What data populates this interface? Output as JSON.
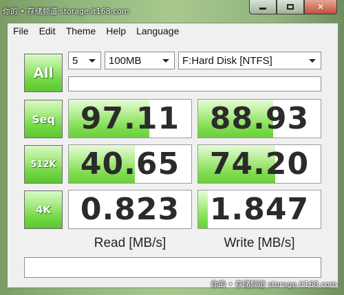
{
  "window": {
    "title": "你的 • 存储频道 storage.it168.com",
    "controls": {
      "minimize_icon": "minimize-icon",
      "maximize_icon": "maximize-icon",
      "close_label": "✕"
    }
  },
  "menu": [
    "File",
    "Edit",
    "Theme",
    "Help",
    "Language"
  ],
  "toolbar": {
    "all_label": "All",
    "count": "5",
    "size": "100MB",
    "drive": "F:Hard Disk [NTFS]",
    "comment": ""
  },
  "tests": [
    {
      "label": "Seq",
      "read": "97.11",
      "read_fill": 0.66,
      "write": "88.93",
      "write_fill": 0.61
    },
    {
      "label": "512K",
      "read": "40.65",
      "read_fill": 0.54,
      "write": "74.20",
      "write_fill": 0.63
    },
    {
      "label": "4K",
      "read": "0.823",
      "read_fill": 0.0,
      "write": "1.847",
      "write_fill": 0.08
    }
  ],
  "headers": {
    "read": "Read [MB/s]",
    "write": "Write [MB/s]"
  },
  "status": "",
  "watermark": "你的 • 存储频道 storage.it168.com",
  "colors": {
    "accent_green": "#72d843",
    "titlebar_close": "#c2503a"
  }
}
